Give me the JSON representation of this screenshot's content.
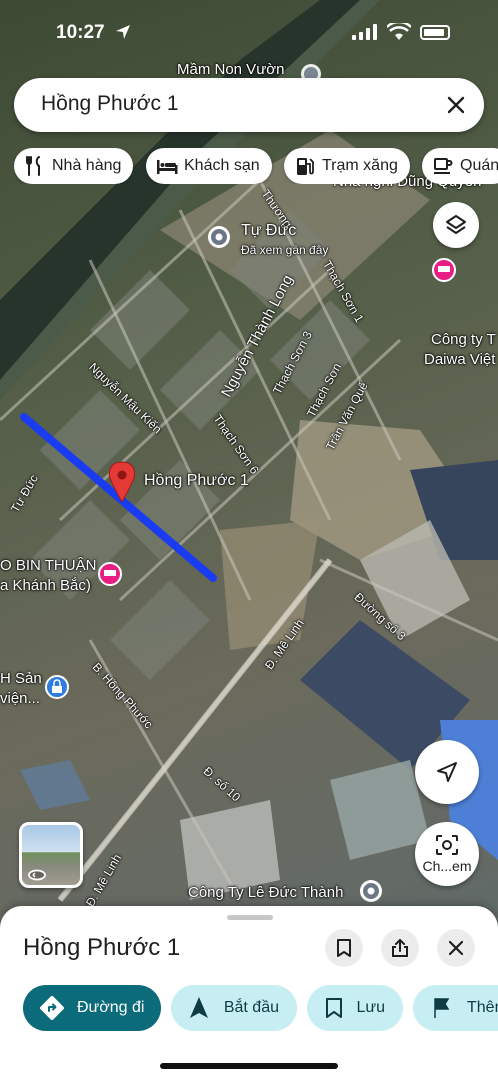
{
  "status_bar": {
    "time": "10:27"
  },
  "search": {
    "query": "Hồng Phước 1"
  },
  "chips": [
    {
      "label": "Nhà hàng",
      "icon": "restaurant-icon"
    },
    {
      "label": "Khách sạn",
      "icon": "hotel-icon"
    },
    {
      "label": "Trạm xăng",
      "icon": "gas-station-icon"
    },
    {
      "label": "Quán",
      "icon": "cafe-icon"
    }
  ],
  "map": {
    "pin_label": "Hồng Phước 1",
    "labels": {
      "mam_non": "Mầm Non Vườn",
      "thuong": "Thương",
      "nha_nghi": "Nhà nghỉ Dũng Quyên",
      "tu_duc_poi": "Tự Đức",
      "tu_duc_sub": "Đã xem gần đây",
      "nguyen_thanh_long": "Nguyễn Thành Long",
      "thach_son_1": "Thạch Sơn 1",
      "thach_son_3": "Thạch Sơn 3",
      "thach_son": "Thạch Sơn",
      "thach_son_6": "Thạch Sơn 6",
      "tran_van_que": "Trần Văn Quế",
      "cong_ty_daiwa_1": "Công ty T",
      "cong_ty_daiwa_2": "Daiwa Việt",
      "nguyen_mau_kien": "Nguyễn Mậu Kiến",
      "tu_duc_road": "Tự Đức",
      "bin_thuan_1": "O BIN THUẬN",
      "bin_thuan_2": "a Khánh Bắc)",
      "duong_so_3": "Đường số 3",
      "d_me_linh": "Đ. Mê Linh",
      "h_san_1": "H Sản",
      "h_san_2": "viện...",
      "b_hong_phuoc": "B. Hồng Phước",
      "d_so_10": "Đ. số 10",
      "me_linh_short": "Đ. Mê Linh",
      "cong_ty_le_duc_thanh": "Công Ty Lê Đức Thành"
    },
    "colors": {
      "route": "#1a3cf0",
      "pin": "#e53935",
      "hotel": "#e91e82",
      "poi": "#5f6b75"
    }
  },
  "buttons": {
    "layers": "layers-icon",
    "locate": "navigation-arrow-icon",
    "scan_label": "Ch...em"
  },
  "sheet": {
    "title": "Hồng Phước 1",
    "actions": [
      {
        "label": "Đường đi",
        "icon": "directions-icon",
        "style": "primary"
      },
      {
        "label": "Bắt đầu",
        "icon": "navigation-icon",
        "style": "secondary"
      },
      {
        "label": "Lưu",
        "icon": "bookmark-icon",
        "style": "secondary"
      },
      {
        "label": "Thên",
        "icon": "flag-icon",
        "style": "secondary"
      }
    ]
  }
}
